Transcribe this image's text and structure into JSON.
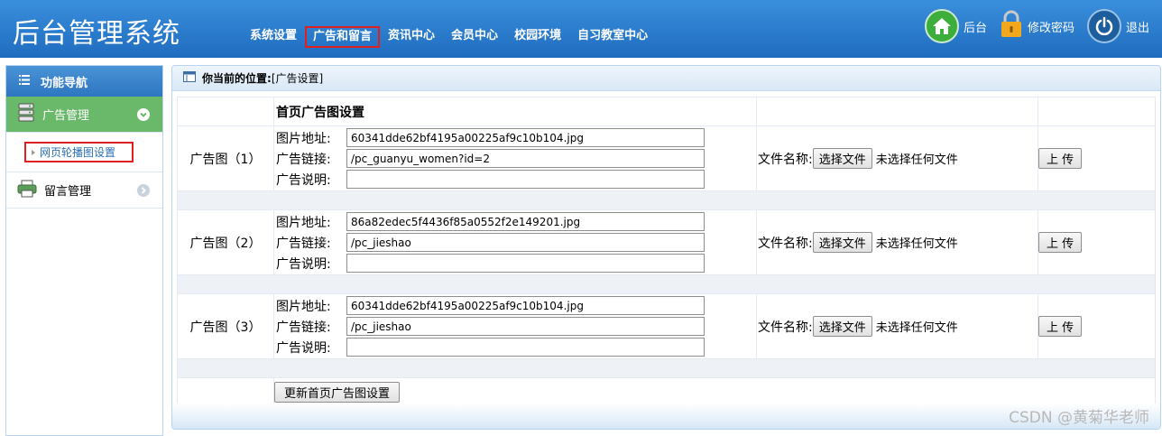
{
  "header": {
    "app_title": "后台管理系统",
    "nav": [
      {
        "label": "系统设置",
        "active": false
      },
      {
        "label": "广告和留言",
        "active": true
      },
      {
        "label": "资讯中心",
        "active": false
      },
      {
        "label": "会员中心",
        "active": false
      },
      {
        "label": "校园环境",
        "active": false
      },
      {
        "label": "自习教室中心",
        "active": false
      }
    ],
    "actions": {
      "home_label": "后台",
      "password_label": "修改密码",
      "logout_label": "退出"
    }
  },
  "sidebar": {
    "title": "功能导航",
    "groups": [
      {
        "label": "广告管理",
        "expanded": true
      },
      {
        "label": "留言管理",
        "expanded": false
      }
    ],
    "active_sub_item": "网页轮播图设置"
  },
  "breadcrumb": {
    "label": "你当前的位置:",
    "location": "[广告设置]"
  },
  "form": {
    "section_title": "首页广告图设置",
    "field_labels": {
      "image": "图片地址:",
      "link": "广告链接:",
      "desc": "广告说明:"
    },
    "file_label": "文件名称:",
    "choose_file": "选择文件",
    "no_file": "未选择任何文件",
    "upload": "上 传",
    "ads": [
      {
        "label": "广告图（1）",
        "image": "60341dde62bf4195a00225af9c10b104.jpg",
        "link": "/pc_guanyu_women?id=2",
        "desc": ""
      },
      {
        "label": "广告图（2）",
        "image": "86a82edec5f4436f85a0552f2e149201.jpg",
        "link": "/pc_jieshao",
        "desc": ""
      },
      {
        "label": "广告图（3）",
        "image": "60341dde62bf4195a00225af9c10b104.jpg",
        "link": "/pc_jieshao",
        "desc": ""
      }
    ],
    "submit": "更新首页广告图设置"
  },
  "watermark": "CSDN @黄菊华老师"
}
